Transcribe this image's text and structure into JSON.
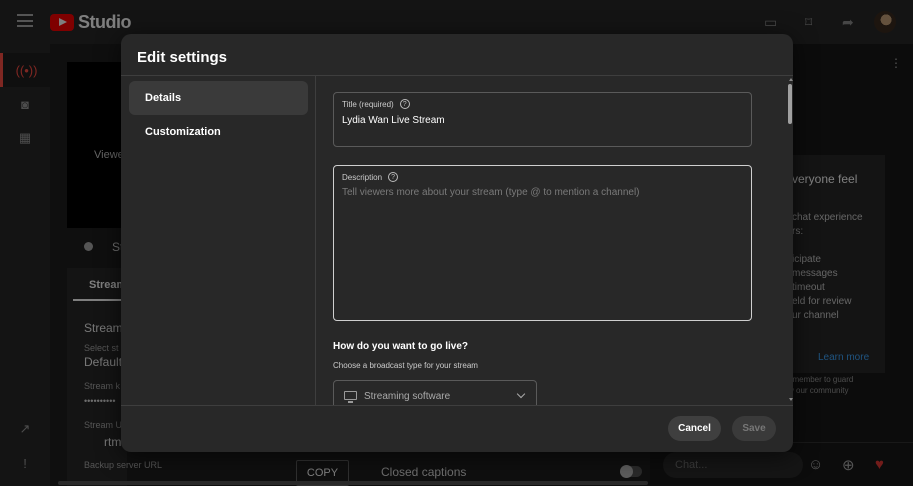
{
  "app": {
    "logo_text": "Studio"
  },
  "background": {
    "preview_text": "Viewe",
    "status_label": "St",
    "stream_tab": "Stream",
    "stream_heading": "Stream",
    "select_label": "Select st",
    "select_value": "Default",
    "stream_key_label": "Stream k",
    "stream_key_value": "••••••••••",
    "stream_url_label": "Stream U",
    "stream_url_value": "rtm",
    "backup_label": "Backup server URL",
    "copy_label": "COPY",
    "cc_label": "Closed captions"
  },
  "chat": {
    "card_title": "veryone feel",
    "card_lines": [
      "chat experience",
      "rs:",
      "icipate",
      "messages",
      "timeout",
      "eld for review",
      "ur channel"
    ],
    "learn_more": "Learn more",
    "notice_line1": "emember to guard",
    "notice_line2": "w our community",
    "input_placeholder": "Chat..."
  },
  "dialog": {
    "title": "Edit settings",
    "nav": [
      {
        "label": "Details",
        "active": true
      },
      {
        "label": "Customization",
        "active": false
      }
    ],
    "title_field": {
      "label": "Title (required)",
      "value": "Lydia Wan Live Stream"
    },
    "description_field": {
      "label": "Description",
      "placeholder": "Tell viewers more about your stream (type @ to mention a channel)"
    },
    "go_live": {
      "heading": "How do you want to go live?",
      "subheading": "Choose a broadcast type for your stream",
      "selected": "Streaming software"
    },
    "cancel_label": "Cancel",
    "save_label": "Save"
  },
  "colors": {
    "accent": "#ff4e45",
    "link": "#3ea6ff",
    "dialog_bg": "#282828",
    "page_bg": "#1f1f1f"
  },
  "icons": [
    "menu-icon",
    "youtube-logo-icon",
    "captions-icon",
    "bookmark-icon",
    "share-icon",
    "live-icon",
    "camera-icon",
    "calendar-icon",
    "external-link-icon",
    "feedback-icon",
    "help-icon",
    "monitor-icon",
    "chevron-down-icon",
    "emoji-icon",
    "add-icon",
    "heart-icon"
  ]
}
